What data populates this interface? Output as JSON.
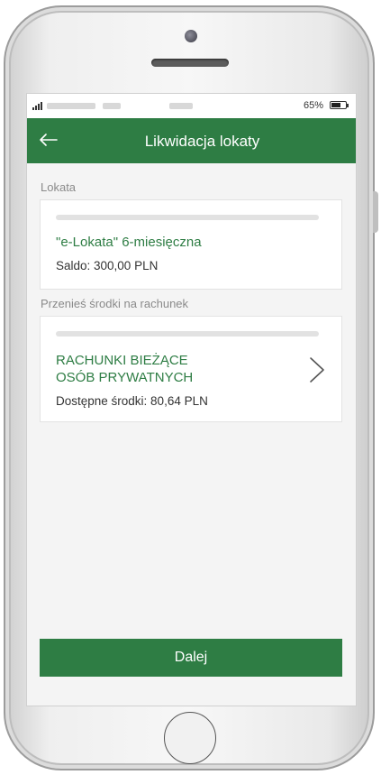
{
  "status": {
    "battery": "65%"
  },
  "header": {
    "title": "Likwidacja lokaty",
    "back_icon": "arrow-left-icon"
  },
  "deposit_section": {
    "label": "Lokata",
    "name": "\"e-Lokata\" 6-miesięczna",
    "balance": "Saldo: 300,00 PLN"
  },
  "transfer_section": {
    "label": "Przenieś środki na rachunek",
    "account_name_line1": "RACHUNKI BIEŻĄCE",
    "account_name_line2": "OSÓB PRYWATNYCH",
    "available": "Dostępne środki: 80,64 PLN",
    "chevron_icon": "chevron-right-icon"
  },
  "footer": {
    "next_label": "Dalej"
  },
  "colors": {
    "brand_green": "#2e7d44",
    "screen_bg": "#f4f4f4"
  }
}
